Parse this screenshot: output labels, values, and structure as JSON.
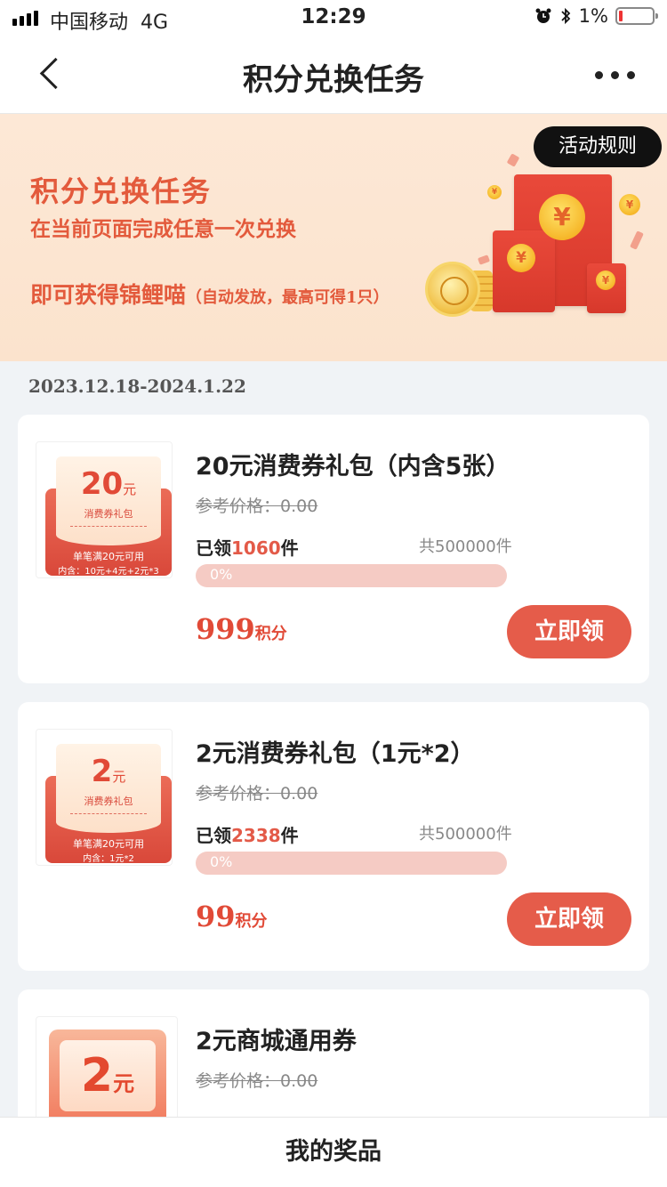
{
  "status_bar": {
    "carrier": "中国移动",
    "network": "4G",
    "time": "12:29",
    "battery": "1%"
  },
  "nav": {
    "title": "积分兑换任务"
  },
  "banner": {
    "title": "积分兑换任务",
    "subtitle": "在当前页面完成任意一次兑换",
    "reward": "即可获得锦鲤喵",
    "reward_note": "（自动发放，最高可得1只）",
    "rules_label": "活动规则",
    "currency_symbol": "¥"
  },
  "date_range": "2023.12.18-2024.1.22",
  "products": [
    {
      "title": "20元消费券礼包（内含5张）",
      "ref_price": "参考价格：0.00",
      "claimed_prefix": "已领",
      "claimed": "1060",
      "claimed_suffix": "件",
      "total": "共500000件",
      "progress_label": "0%",
      "progress": 0,
      "points": "999",
      "points_unit": "积分",
      "button": "立即领",
      "thumb": {
        "value": "20",
        "unit": "元",
        "kind": "消费券礼包",
        "line1": "单笔满20元可用",
        "line2": "内含：10元+4元+2元*3"
      }
    },
    {
      "title": "2元消费券礼包（1元*2）",
      "ref_price": "参考价格：0.00",
      "claimed_prefix": "已领",
      "claimed": "2338",
      "claimed_suffix": "件",
      "total": "共500000件",
      "progress_label": "0%",
      "progress": 0,
      "points": "99",
      "points_unit": "积分",
      "button": "立即领",
      "thumb": {
        "value": "2",
        "unit": "元",
        "kind": "消费券礼包",
        "line1": "单笔满20元可用",
        "line2": "内含：1元*2"
      }
    },
    {
      "title": "2元商城通用券",
      "ref_price": "参考价格：0.00",
      "thumb": {
        "value": "2",
        "unit": "元"
      }
    }
  ],
  "bottom_bar": {
    "label": "我的奖品"
  },
  "colors": {
    "accent": "#e55c4a",
    "banner_bg": "#fde8d6",
    "progress_bg": "#f5cbc4"
  }
}
